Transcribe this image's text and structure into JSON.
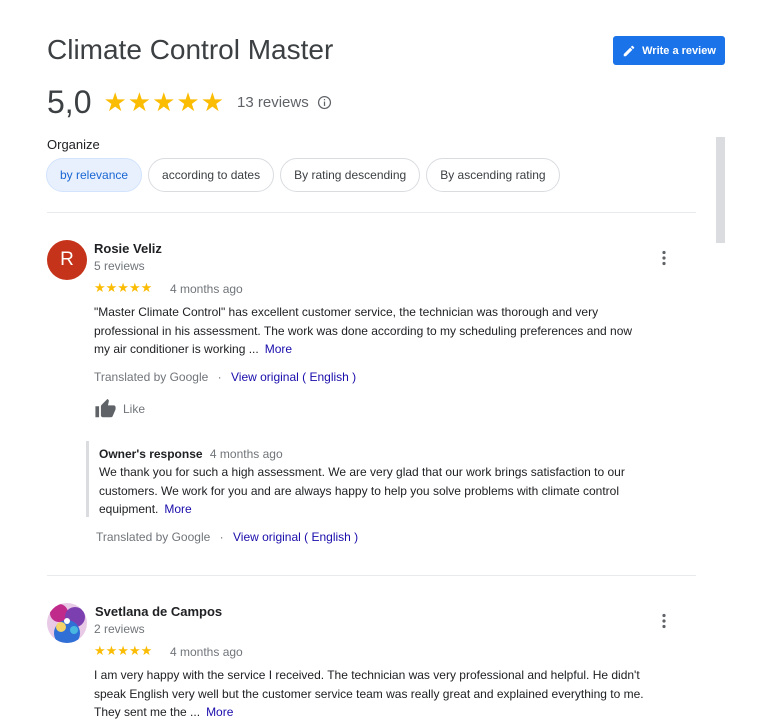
{
  "header": {
    "title": "Climate Control Master",
    "write_review_label": "Write a review",
    "rating_value": "5,0",
    "stars": "★★★★★",
    "review_count": "13 reviews"
  },
  "sort": {
    "label": "Organize",
    "options": [
      "by relevance",
      "according to dates",
      "By rating descending",
      "By ascending rating"
    ],
    "selected": "by relevance"
  },
  "reviews": [
    {
      "avatar_letter": "R",
      "avatar_color": "#c5341a",
      "name": "Rosie Veliz",
      "count": "5 reviews",
      "stars": "★★★★★",
      "rating": 5,
      "time": "4 months ago",
      "lines": [
        "\"Master Climate Control\" has excellent customer service, the technician was thorough and very",
        "professional in his assessment. The work was done according to my scheduling preferences and now",
        "my air conditioner is working ..."
      ],
      "more": "More",
      "translated_by": "Translated by Google",
      "view_original": "View original ( English )",
      "like": "Like",
      "owner": {
        "label": "Owner's response",
        "time": "4 months ago",
        "lines": [
          "We thank you for such a high assessment. We are very glad that our work brings satisfaction to our",
          "customers. We work for you and are always happy to help you solve problems with climate control",
          "equipment."
        ],
        "more": "More",
        "translated_by": "Translated by Google",
        "view_original": "View original ( English )"
      }
    },
    {
      "avatar_icon": "profile-photo",
      "name": "Svetlana de Campos",
      "count": "2 reviews",
      "stars": "★★★★★",
      "rating": 5,
      "time": "4 months ago",
      "lines": [
        "I am very happy with the service I received. The technician was very professional and helpful. He didn't",
        "speak English very well but the customer service team was really great and explained everything to me.",
        "They sent me the ..."
      ],
      "more": "More"
    }
  ],
  "colors": {
    "accent": "#1a73e8",
    "star": "#fbbc04",
    "link": "#1a0dab",
    "chip_active_bg": "#e8f0fe"
  }
}
